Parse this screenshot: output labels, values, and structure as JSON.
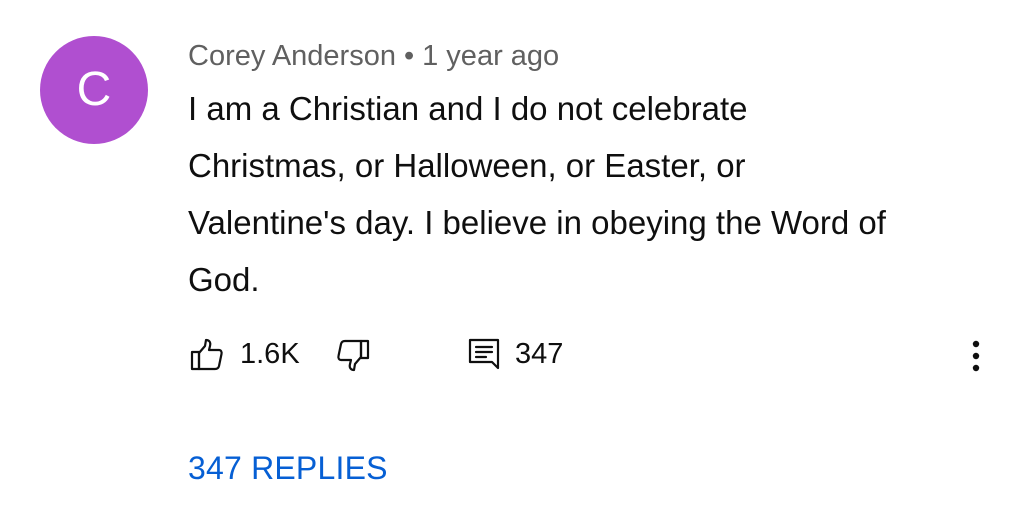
{
  "comment": {
    "avatar_letter": "C",
    "avatar_color": "#b04fd0",
    "author": "Corey Anderson",
    "separator": "•",
    "time_ago": "1 year ago",
    "text_lines": [
      "I am a Christian and I do not celebrate",
      "Christmas, or Halloween, or Easter, or",
      "Valentine's day. I believe in obeying the Word of",
      "God."
    ]
  },
  "actions": {
    "like_icon": "thumbs-up-icon",
    "like_count": "1.6K",
    "dislike_icon": "thumbs-down-icon",
    "reply_icon": "comment-icon",
    "reply_count": "347",
    "more_icon": "more-vertical-icon"
  },
  "replies": {
    "label": "347 REPLIES",
    "link_color": "#065fd4"
  }
}
